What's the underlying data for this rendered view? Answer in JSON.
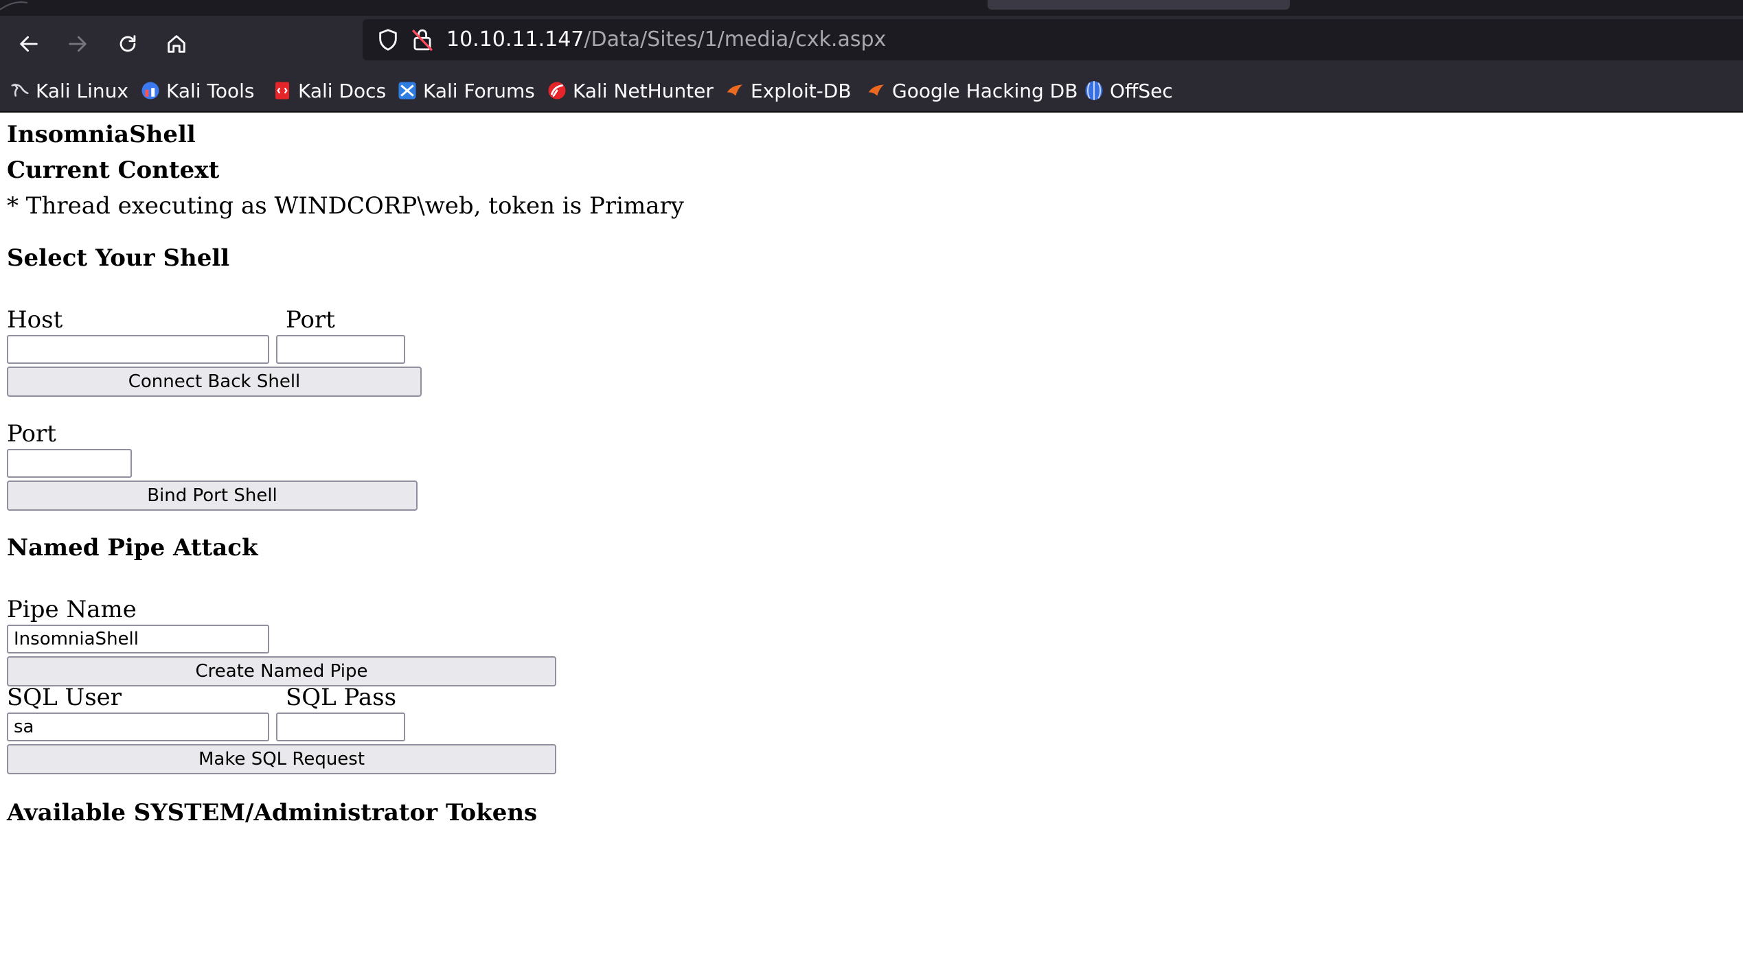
{
  "browser": {
    "url_host": "10.10.11.147",
    "url_path": "/Data/Sites/1/media/cxk.aspx",
    "bookmarks": [
      {
        "label": "Kali Linux",
        "icon": "kali-dragon-icon"
      },
      {
        "label": "Kali Tools",
        "icon": "kali-tools-icon"
      },
      {
        "label": "Kali Docs",
        "icon": "kali-docs-icon"
      },
      {
        "label": "Kali Forums",
        "icon": "kali-forums-icon"
      },
      {
        "label": "Kali NetHunter",
        "icon": "kali-nethunter-icon"
      },
      {
        "label": "Exploit-DB",
        "icon": "exploit-db-icon"
      },
      {
        "label": "Google Hacking DB",
        "icon": "google-hacking-db-icon"
      },
      {
        "label": "OffSec",
        "icon": "offsec-icon"
      }
    ]
  },
  "page": {
    "title": "InsomniaShell",
    "context_heading": "Current Context",
    "context_text": "* Thread executing as WINDCORP\\web, token is Primary",
    "select_shell_heading": "Select Your Shell",
    "connect_back": {
      "host_label": "Host",
      "port_label": "Port",
      "host_value": "",
      "port_value": "",
      "button": "Connect Back Shell"
    },
    "bind_port": {
      "port_label": "Port",
      "port_value": "",
      "button": "Bind Port Shell"
    },
    "named_pipe_heading": "Named Pipe Attack",
    "named_pipe": {
      "pipe_label": "Pipe Name",
      "pipe_value": "InsomniaShell",
      "button": "Create Named Pipe"
    },
    "sql": {
      "user_label": "SQL User",
      "pass_label": "SQL Pass",
      "user_value": "sa",
      "pass_value": "",
      "button": "Make SQL Request"
    },
    "tokens_heading": "Available SYSTEM/Administrator Tokens"
  },
  "colors": {
    "toolbar": "#2b2a33",
    "urlbar": "#1c1b22",
    "button_bg": "#e9e9ed",
    "field_border": "#8f8f9d"
  }
}
